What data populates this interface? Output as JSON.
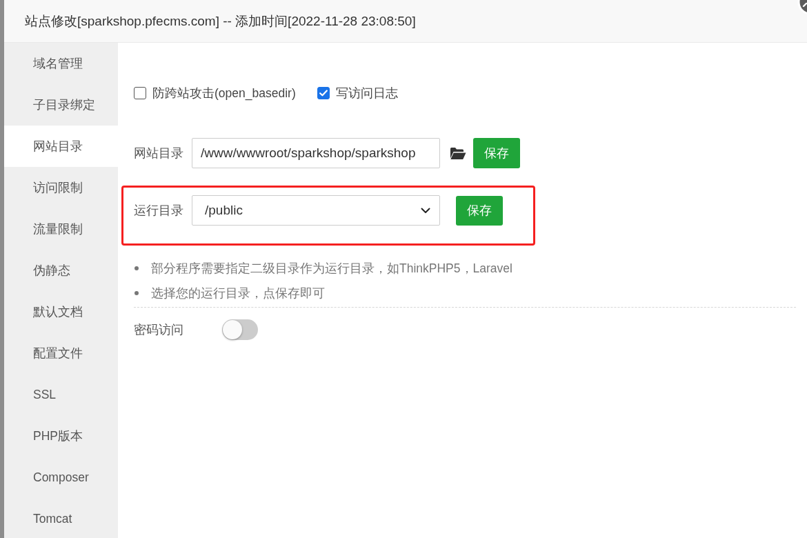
{
  "window": {
    "title": "站点修改[sparkshop.pfecms.com] -- 添加时间[2022-11-28 23:08:50]"
  },
  "sidebar": {
    "items": [
      {
        "label": "域名管理",
        "selected": false
      },
      {
        "label": "子目录绑定",
        "selected": false
      },
      {
        "label": "网站目录",
        "selected": true
      },
      {
        "label": "访问限制",
        "selected": false
      },
      {
        "label": "流量限制",
        "selected": false
      },
      {
        "label": "伪静态",
        "selected": false
      },
      {
        "label": "默认文档",
        "selected": false
      },
      {
        "label": "配置文件",
        "selected": false
      },
      {
        "label": "SSL",
        "selected": false
      },
      {
        "label": "PHP版本",
        "selected": false
      },
      {
        "label": "Composer",
        "selected": false
      },
      {
        "label": "Tomcat",
        "selected": false
      }
    ]
  },
  "options": [
    {
      "label": "防跨站攻击(open_basedir)",
      "checked": false
    },
    {
      "label": "写访问日志",
      "checked": true
    }
  ],
  "directory_rows": [
    {
      "kind": "input",
      "label": "网站目录",
      "value": "/www/wwwroot/sparkshop/sparkshop",
      "button": "保存",
      "highlighted": false
    },
    {
      "kind": "select",
      "label": "运行目录",
      "value": "/public",
      "button": "保存",
      "highlighted": true
    }
  ],
  "hints": [
    "部分程序需要指定二级目录作为运行目录，如ThinkPHP5，Laravel",
    "选择您的运行目录，点保存即可"
  ],
  "password_access": {
    "label": "密码访问",
    "on": false
  }
}
